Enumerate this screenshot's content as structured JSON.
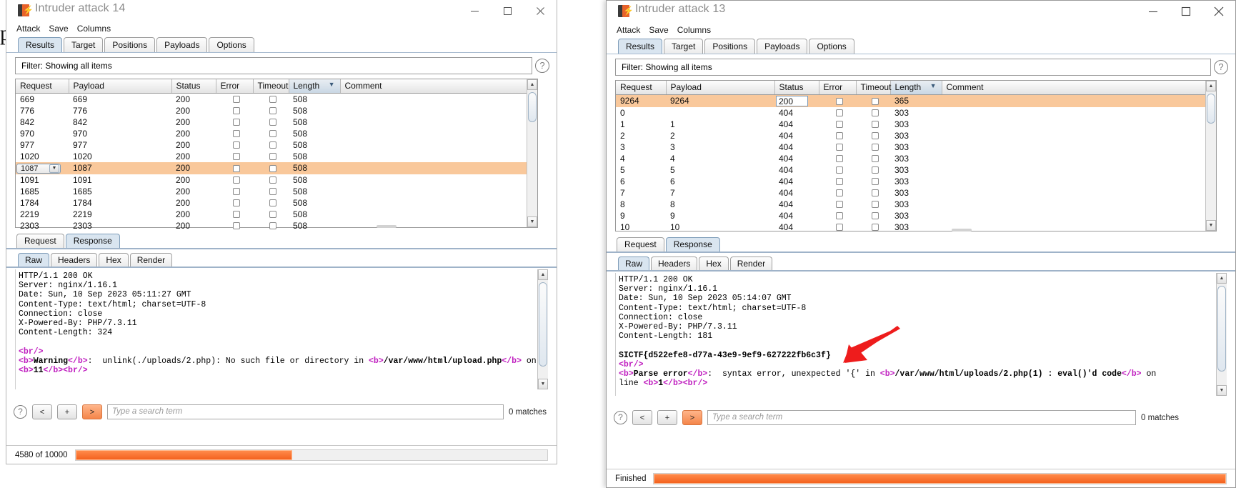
{
  "background_letter": "p",
  "windows": [
    {
      "id": "left",
      "title": "Intruder attack 14",
      "menu": [
        "Attack",
        "Save",
        "Columns"
      ],
      "tabs": [
        "Results",
        "Target",
        "Positions",
        "Payloads",
        "Options"
      ],
      "active_tab": "Results",
      "filter_label": "Filter:",
      "filter_value": "Showing all items",
      "columns": [
        "Request",
        "Payload",
        "Status",
        "Error",
        "Timeout",
        "Length",
        "Comment"
      ],
      "sorted_column": "Length",
      "sort_indicator": "▼",
      "rows": [
        {
          "request": "669",
          "payload": "669",
          "status": "200",
          "error": false,
          "timeout": false,
          "length": "508",
          "comment": "",
          "selected": false
        },
        {
          "request": "776",
          "payload": "776",
          "status": "200",
          "error": false,
          "timeout": false,
          "length": "508",
          "comment": "",
          "selected": false
        },
        {
          "request": "842",
          "payload": "842",
          "status": "200",
          "error": false,
          "timeout": false,
          "length": "508",
          "comment": "",
          "selected": false
        },
        {
          "request": "970",
          "payload": "970",
          "status": "200",
          "error": false,
          "timeout": false,
          "length": "508",
          "comment": "",
          "selected": false
        },
        {
          "request": "977",
          "payload": "977",
          "status": "200",
          "error": false,
          "timeout": false,
          "length": "508",
          "comment": "",
          "selected": false
        },
        {
          "request": "1020",
          "payload": "1020",
          "status": "200",
          "error": false,
          "timeout": false,
          "length": "508",
          "comment": "",
          "selected": false
        },
        {
          "request": "1087",
          "payload": "1087",
          "status": "200",
          "error": false,
          "timeout": false,
          "length": "508",
          "comment": "",
          "selected": true
        },
        {
          "request": "1091",
          "payload": "1091",
          "status": "200",
          "error": false,
          "timeout": false,
          "length": "508",
          "comment": "",
          "selected": false
        },
        {
          "request": "1685",
          "payload": "1685",
          "status": "200",
          "error": false,
          "timeout": false,
          "length": "508",
          "comment": "",
          "selected": false
        },
        {
          "request": "1784",
          "payload": "1784",
          "status": "200",
          "error": false,
          "timeout": false,
          "length": "508",
          "comment": "",
          "selected": false
        },
        {
          "request": "2219",
          "payload": "2219",
          "status": "200",
          "error": false,
          "timeout": false,
          "length": "508",
          "comment": "",
          "selected": false
        },
        {
          "request": "2303",
          "payload": "2303",
          "status": "200",
          "error": false,
          "timeout": false,
          "length": "508",
          "comment": "",
          "selected": false
        }
      ],
      "message_tabs": [
        "Request",
        "Response"
      ],
      "active_message_tab": "Response",
      "view_tabs": [
        "Raw",
        "Headers",
        "Hex",
        "Render"
      ],
      "active_view_tab": "Raw",
      "response_headers": [
        "HTTP/1.1 200 OK",
        "Server: nginx/1.16.1",
        "Date: Sun, 10 Sep 2023 05:11:27 GMT",
        "Content-Type: text/html; charset=UTF-8",
        "Connection: close",
        "X-Powered-By: PHP/7.3.11",
        "Content-Length: 324"
      ],
      "response_body": [
        "<br />",
        "<b>Warning</b>:  unlink(./uploads/2.php): No such file or directory in <b>/var/www/html/upload.php</b> on line",
        "<b>11</b><br />"
      ],
      "search": {
        "prev_label": "<",
        "add_label": "+",
        "next_label": ">",
        "placeholder": "Type a search term",
        "value": "",
        "matches": "0 matches",
        "help_label": "?"
      },
      "status": {
        "text": "4580 of 10000",
        "progress_percent": 46
      }
    },
    {
      "id": "right",
      "title": "Intruder attack 13",
      "menu": [
        "Attack",
        "Save",
        "Columns"
      ],
      "tabs": [
        "Results",
        "Target",
        "Positions",
        "Payloads",
        "Options"
      ],
      "active_tab": "Results",
      "filter_label": "Filter:",
      "filter_value": "Showing all items",
      "columns": [
        "Request",
        "Payload",
        "Status",
        "Error",
        "Timeout",
        "Length",
        "Comment"
      ],
      "sorted_column": "Length",
      "sort_indicator": "▼",
      "rows": [
        {
          "request": "9264",
          "payload": "9264",
          "status": "200",
          "error": false,
          "timeout": false,
          "length": "365",
          "comment": "",
          "selected": true
        },
        {
          "request": "0",
          "payload": "",
          "status": "404",
          "error": false,
          "timeout": false,
          "length": "303",
          "comment": "",
          "selected": false
        },
        {
          "request": "1",
          "payload": "1",
          "status": "404",
          "error": false,
          "timeout": false,
          "length": "303",
          "comment": "",
          "selected": false
        },
        {
          "request": "2",
          "payload": "2",
          "status": "404",
          "error": false,
          "timeout": false,
          "length": "303",
          "comment": "",
          "selected": false
        },
        {
          "request": "3",
          "payload": "3",
          "status": "404",
          "error": false,
          "timeout": false,
          "length": "303",
          "comment": "",
          "selected": false
        },
        {
          "request": "4",
          "payload": "4",
          "status": "404",
          "error": false,
          "timeout": false,
          "length": "303",
          "comment": "",
          "selected": false
        },
        {
          "request": "5",
          "payload": "5",
          "status": "404",
          "error": false,
          "timeout": false,
          "length": "303",
          "comment": "",
          "selected": false
        },
        {
          "request": "6",
          "payload": "6",
          "status": "404",
          "error": false,
          "timeout": false,
          "length": "303",
          "comment": "",
          "selected": false
        },
        {
          "request": "7",
          "payload": "7",
          "status": "404",
          "error": false,
          "timeout": false,
          "length": "303",
          "comment": "",
          "selected": false
        },
        {
          "request": "8",
          "payload": "8",
          "status": "404",
          "error": false,
          "timeout": false,
          "length": "303",
          "comment": "",
          "selected": false
        },
        {
          "request": "9",
          "payload": "9",
          "status": "404",
          "error": false,
          "timeout": false,
          "length": "303",
          "comment": "",
          "selected": false
        },
        {
          "request": "10",
          "payload": "10",
          "status": "404",
          "error": false,
          "timeout": false,
          "length": "303",
          "comment": "",
          "selected": false
        }
      ],
      "message_tabs": [
        "Request",
        "Response"
      ],
      "active_message_tab": "Response",
      "view_tabs": [
        "Raw",
        "Headers",
        "Hex",
        "Render"
      ],
      "active_view_tab": "Raw",
      "response_headers": [
        "HTTP/1.1 200 OK",
        "Server: nginx/1.16.1",
        "Date: Sun, 10 Sep 2023 05:14:07 GMT",
        "Content-Type: text/html; charset=UTF-8",
        "Connection: close",
        "X-Powered-By: PHP/7.3.11",
        "Content-Length: 181"
      ],
      "flag": "SICTF{d522efe8-d77a-43e9-9ef9-627222fb6c3f}",
      "response_body": [
        "<br />",
        "<b>Parse error</b>:  syntax error, unexpected '{' in <b>/var/www/html/uploads/2.php(1) : eval()'d code</b> on",
        "line <b>1</b><br />"
      ],
      "search": {
        "prev_label": "<",
        "add_label": "+",
        "next_label": ">",
        "placeholder": "Type a search term",
        "value": "",
        "matches": "0 matches",
        "help_label": "?"
      },
      "status": {
        "text": "Finished",
        "progress_percent": 100
      }
    }
  ],
  "annotation": {
    "type": "red-arrow",
    "color": "#ee1c1c",
    "points_at": "flag"
  },
  "colors": {
    "highlight_row": "#f9c89b",
    "accent_orange": "#f4621f",
    "tab_active": "#d9e5f0",
    "annotation_red": "#ee1c1c"
  }
}
